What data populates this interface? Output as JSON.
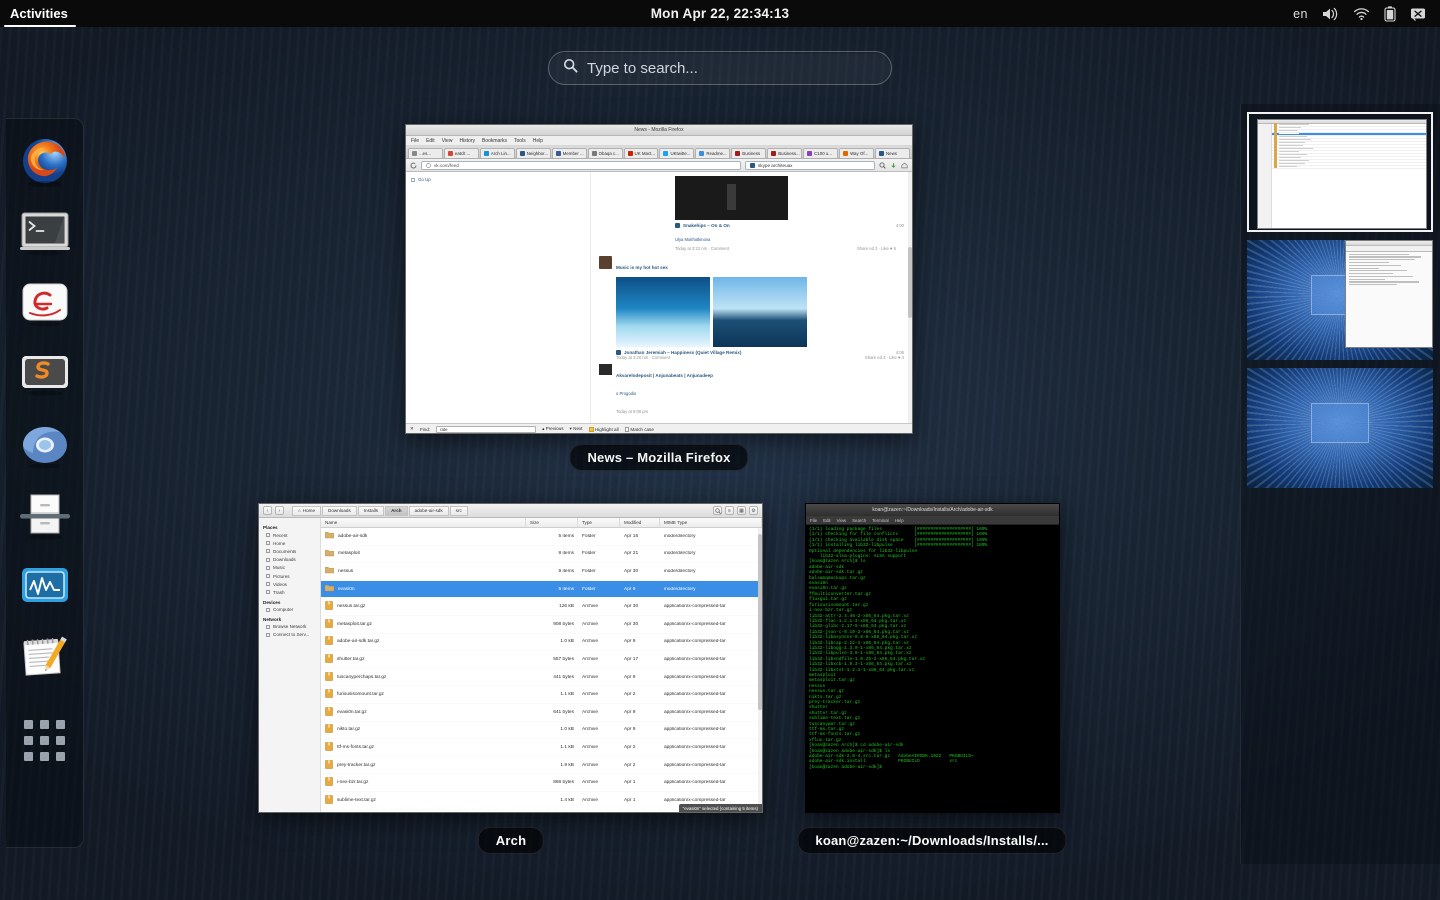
{
  "topbar": {
    "activities_label": "Activities",
    "clock": "Mon Apr 22, 22:34:13",
    "lang": "en",
    "icons": [
      "volume-icon",
      "wifi-icon",
      "battery-icon",
      "power-icon"
    ]
  },
  "search": {
    "placeholder": "Type to search...",
    "icon": "search-icon"
  },
  "dock": {
    "items": [
      {
        "name": "firefox",
        "label": "Firefox"
      },
      {
        "name": "terminal",
        "label": "Terminal"
      },
      {
        "name": "evince",
        "label": "Evince"
      },
      {
        "name": "sublime-text",
        "label": "Sublime Text"
      },
      {
        "name": "chromium",
        "label": "Chromium"
      },
      {
        "name": "files",
        "label": "Files"
      },
      {
        "name": "system-monitor",
        "label": "System Monitor"
      },
      {
        "name": "text-editor",
        "label": "Text Editor"
      }
    ],
    "apps_grid_label": "Show Applications"
  },
  "windows": {
    "firefox": {
      "label": "News – Mozilla Firefox",
      "title": "News - Mozilla Firefox",
      "menus": [
        "File",
        "Edit",
        "View",
        "History",
        "Bookmarks",
        "Tools",
        "Help"
      ],
      "tabs": [
        {
          "label": "...es...",
          "color": "#888888"
        },
        {
          "label": "eatclt ...",
          "color": "#d14836"
        },
        {
          "label": "Arch Lin...",
          "color": "#1793d1"
        },
        {
          "label": "Neighbor...",
          "color": "#2a5885"
        },
        {
          "label": "Member ...",
          "color": "#3b5998"
        },
        {
          "label": "Obaqa c...",
          "color": "#7a7a7a"
        },
        {
          "label": "UK Mact...",
          "color": "#cc2200"
        },
        {
          "label": "UKtwitte...",
          "color": "#1da1f2"
        },
        {
          "label": "Readme...",
          "color": "#3b8ede"
        },
        {
          "label": "Business",
          "color": "#a11d1d"
        },
        {
          "label": "Business...",
          "color": "#a11d1d"
        },
        {
          "label": "C100 u...",
          "color": "#8a3fbf"
        },
        {
          "label": "Way Of...",
          "color": "#e06a00"
        },
        {
          "label": "News",
          "color": "#2a5885"
        }
      ],
      "url": "vk.com/feed",
      "search_value": "skype architeuax",
      "findbar": {
        "find_label": "Find:",
        "find_value": "rate",
        "previous": "Previous",
        "next": "Next",
        "highlight": "Highlight all",
        "match_case": "Match case"
      },
      "feed": {
        "posts": [
          {
            "title": "Snakehips – On & On",
            "author": "Ulya Mukhotkinova",
            "meta": "Today at 3:22 nm · Comment",
            "stats": "Share ed 3 · Like ♥ 5",
            "time": "4:00"
          },
          {
            "title": "Music is my hot hot sex",
            "author": "Jonathan Jeremiah – Happiness (Quiet Village Remix)",
            "meta": "Today at 3:20 nm · Comment",
            "stats": "Share ed 3 · Like ♥ 4",
            "time": "4:06"
          },
          {
            "title": "Akvarelodeposit | Anjunabeats | Anjunadeep",
            "author": "o Progodio",
            "meta": "Today at 9:08 pm",
            "stats": "",
            "time": ""
          }
        ],
        "nav_label": "Go Up"
      }
    },
    "nautilus": {
      "label": "Arch",
      "breadcrumbs": [
        "Home",
        "Downloads",
        "Installs",
        "Arch",
        "adobe-air-sdk",
        "src"
      ],
      "active_breadcrumb_index": 3,
      "toolbar_icons": [
        "back-icon",
        "forward-icon",
        "search-icon",
        "view-list-icon",
        "view-grid-icon",
        "gear-icon"
      ],
      "sidebar": {
        "places_header": "Places",
        "places": [
          "Recent",
          "Home",
          "Documents",
          "Downloads",
          "Music",
          "Pictures",
          "Videos",
          "Trash"
        ],
        "devices_header": "Devices",
        "devices": [
          "Computer"
        ],
        "network_header": "Network",
        "network": [
          "Browse Network",
          "Connect to Serv..."
        ]
      },
      "columns": [
        "Name",
        "Size",
        "Type",
        "Modified",
        "MIME Type"
      ],
      "rows": [
        {
          "name": "adobe-air-sdk",
          "size": "5 items",
          "type": "Folder",
          "modified": "Apr 16",
          "mime": "inode/directory",
          "kind": "folder",
          "selected": false
        },
        {
          "name": "metasploit",
          "size": "8 items",
          "type": "Folder",
          "modified": "Apr 21",
          "mime": "inode/directory",
          "kind": "folder",
          "selected": false
        },
        {
          "name": "nessus",
          "size": "9 items",
          "type": "Folder",
          "modified": "Apr 30",
          "mime": "inode/directory",
          "kind": "folder",
          "selected": false
        },
        {
          "name": "evasi0n",
          "size": "5 items",
          "type": "Folder",
          "modified": "Apr 9",
          "mime": "inode/directory",
          "kind": "folder",
          "selected": true
        },
        {
          "name": "nessus.tar.gz",
          "size": "126 kB",
          "type": "Archive",
          "modified": "Apr 30",
          "mime": "application/x-compressed-tar",
          "kind": "archive",
          "selected": false
        },
        {
          "name": "metasploit.tar.gz",
          "size": "908 bytes",
          "type": "Archive",
          "modified": "Apr 30",
          "mime": "application/x-compressed-tar",
          "kind": "archive",
          "selected": false
        },
        {
          "name": "adobe-air-sdk.tar.gz",
          "size": "1.0 kB",
          "type": "Archive",
          "modified": "Apr 9",
          "mime": "application/x-compressed-tar",
          "kind": "archive",
          "selected": false
        },
        {
          "name": "shutter.tar.gz",
          "size": "557 bytes",
          "type": "Archive",
          "modified": "Apr 17",
          "mime": "application/x-compressed-tar",
          "kind": "archive",
          "selected": false
        },
        {
          "name": "tuscanyperchaps.tar.gz",
          "size": "441 bytes",
          "type": "Archive",
          "modified": "Apr 9",
          "mime": "application/x-compressed-tar",
          "kind": "archive",
          "selected": false
        },
        {
          "name": "furiousisomount.tar.gz",
          "size": "1.1 kB",
          "type": "Archive",
          "modified": "Apr 2",
          "mime": "application/x-compressed-tar",
          "kind": "archive",
          "selected": false
        },
        {
          "name": "evasi0n.tar.gz",
          "size": "641 bytes",
          "type": "Archive",
          "modified": "Apr 9",
          "mime": "application/x-compressed-tar",
          "kind": "archive",
          "selected": false
        },
        {
          "name": "nikto.tar.gz",
          "size": "1.0 kB",
          "type": "Archive",
          "modified": "Apr 9",
          "mime": "application/x-compressed-tar",
          "kind": "archive",
          "selected": false
        },
        {
          "name": "ttf-ms-fonts.tar.gz",
          "size": "1.1 kB",
          "type": "Archive",
          "modified": "Apr 2",
          "mime": "application/x-compressed-tar",
          "kind": "archive",
          "selected": false
        },
        {
          "name": "prey-tracker.tar.gz",
          "size": "1.9 kB",
          "type": "Archive",
          "modified": "Apr 2",
          "mime": "application/x-compressed-tar",
          "kind": "archive",
          "selected": false
        },
        {
          "name": "i-nex-bzr.tar.gz",
          "size": "866 bytes",
          "type": "Archive",
          "modified": "Apr 1",
          "mime": "application/x-compressed-tar",
          "kind": "archive",
          "selected": false
        },
        {
          "name": "sublime-text.tar.gz",
          "size": "1.4 kB",
          "type": "Archive",
          "modified": "Apr 1",
          "mime": "application/x-compressed-tar",
          "kind": "archive",
          "selected": false
        }
      ],
      "status": "\"evasi0n\" selected (containing 5 items)"
    },
    "terminal": {
      "label": "koan@zazen:~/Downloads/Installs/...",
      "title": "koan@zazen:~/Downloads/Installs/Arch/adobe-air-sdk",
      "menus": [
        "File",
        "Edit",
        "View",
        "Search",
        "Terminal",
        "Help"
      ],
      "lines": [
        "(1/1) loading package files            [####################] 100%",
        "(1/1) checking for file conflicts      [####################] 100%",
        "(1/1) checking available disk space    [####################] 100%",
        "(1/1) installing lib32-libpulse        [####################] 100%",
        "Optional dependencies for lib32-libpulse",
        "    lib32-alsa-plugins: ALSA support",
        "[koan@zazen Arch]$ ls",
        "adobe-air-sdk",
        "adobe-air-sdk.tar.gz",
        "balsamqmockups.tar.gz",
        "evasi0n",
        "evasi0n.tar.gz",
        "ffmulticonverter.tar.gz",
        "fluxgui.tar.gz",
        "furiousisomount.tar.gz",
        "i-nex-bzr.tar.gz",
        "lib32-attr-2.4.46-2-x86_64.pkg.tar.xz",
        "lib32-flac-1.2.1-3-x86_64.pkg.tar.xz",
        "lib32-glibc-2.17-5-x86_64.pkg.tar.xz",
        "lib32-json-c-0.10-2-x86_64.pkg.tar.xz",
        "lib32-libasyncns-0.8-6-x86_64.pkg.tar.xz",
        "lib32-libcap-2.22-1-x86_64.pkg.tar.xz",
        "lib32-libogg-1.3.0-1-x86_64.pkg.tar.xz",
        "lib32-libpulse-3.0-1-x86_64.pkg.tar.xz",
        "lib32-libsndfile-1.0.25-2-x86_64.pkg.tar.xz",
        "lib32-libxcb-1.9.3-1-x86_64.pkg.tar.xz",
        "lib32-libxtst-1.2.1-1-x86_64.pkg.tar.xz",
        "metasploit",
        "metasploit.tar.gz",
        "nessus",
        "nessus.tar.gz",
        "nikto.tar.gz",
        "prey-tracker.tar.gz",
        "shutter",
        "shutter.tar.gz",
        "sublime-text.tar.gz",
        "tuscanywar.tar.gz",
        "ttf-ms.tar.gz",
        "ttf-ms-fonts.tar.gz",
        "xflux.tar.gz",
        "[koan@zazen Arch]$ cd adobe-air-sdk",
        "[koan@zazen adobe-air-sdk]$ ls",
        "adobe-air-sdk-2.6-4.src.tar.gz   AdobeAIRSDK.1022   PKGBUILD~",
        "adobe-air-sdk.install            PKGBUILD           src",
        "[koan@zazen adobe-air-sdk]$ "
      ]
    }
  },
  "workspaces": {
    "items": [
      {
        "name": "workspace-1",
        "active": true,
        "content": "file-manager"
      },
      {
        "name": "workspace-2",
        "active": false,
        "content": "text-editor"
      },
      {
        "name": "workspace-3",
        "active": false,
        "content": "empty"
      }
    ]
  }
}
